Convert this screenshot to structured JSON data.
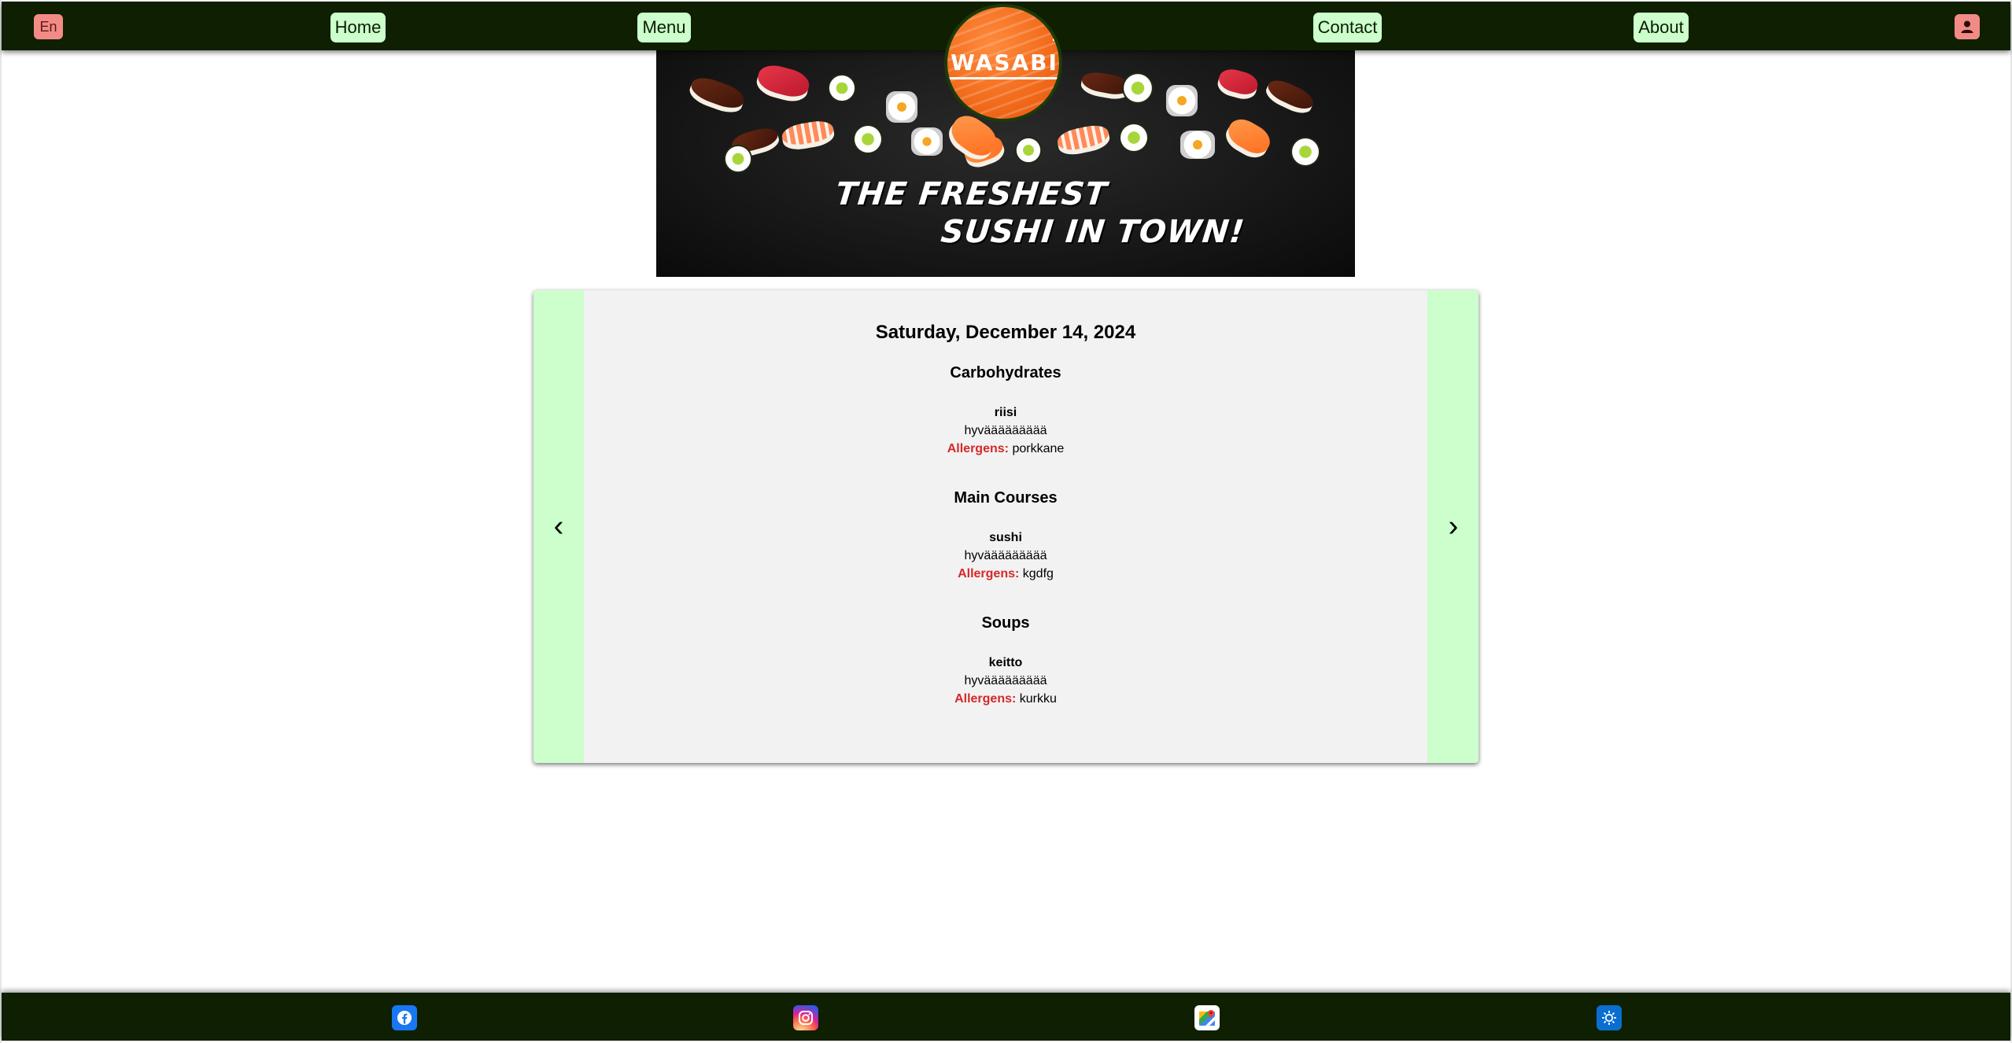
{
  "header": {
    "language_label": "En",
    "nav": {
      "home": "Home",
      "menu": "Menu",
      "contact": "Contact",
      "about": "About"
    },
    "logo_text": "WASABI",
    "user_icon": "user-icon"
  },
  "hero": {
    "line1": "THE FRESHEST",
    "line2": "SUSHI IN TOWN!"
  },
  "menu": {
    "prev_symbol": "‹",
    "next_symbol": "›",
    "date": "Saturday, December 14, 2024",
    "allergens_label": "Allergens:",
    "categories": [
      {
        "title": "Carbohydrates",
        "dish": {
          "name": "riisi",
          "description": "hyväääääääää",
          "allergens": "porkkane"
        }
      },
      {
        "title": "Main Courses",
        "dish": {
          "name": "sushi",
          "description": "hyväääääääää",
          "allergens": "kgdfg"
        }
      },
      {
        "title": "Soups",
        "dish": {
          "name": "keitto",
          "description": "hyväääääääää",
          "allergens": "kurkku"
        }
      }
    ]
  },
  "footer": {
    "icons": [
      "facebook-icon",
      "instagram-icon",
      "google-maps-icon",
      "settings-icon"
    ]
  },
  "colors": {
    "header_bg": "#0f1f02",
    "nav_button_bg": "#ccffcc",
    "accent_pink": "#f28b86",
    "allergen_red": "#d62828",
    "card_side_green": "#ccffcc",
    "card_center_gray": "#f2f2f2"
  }
}
